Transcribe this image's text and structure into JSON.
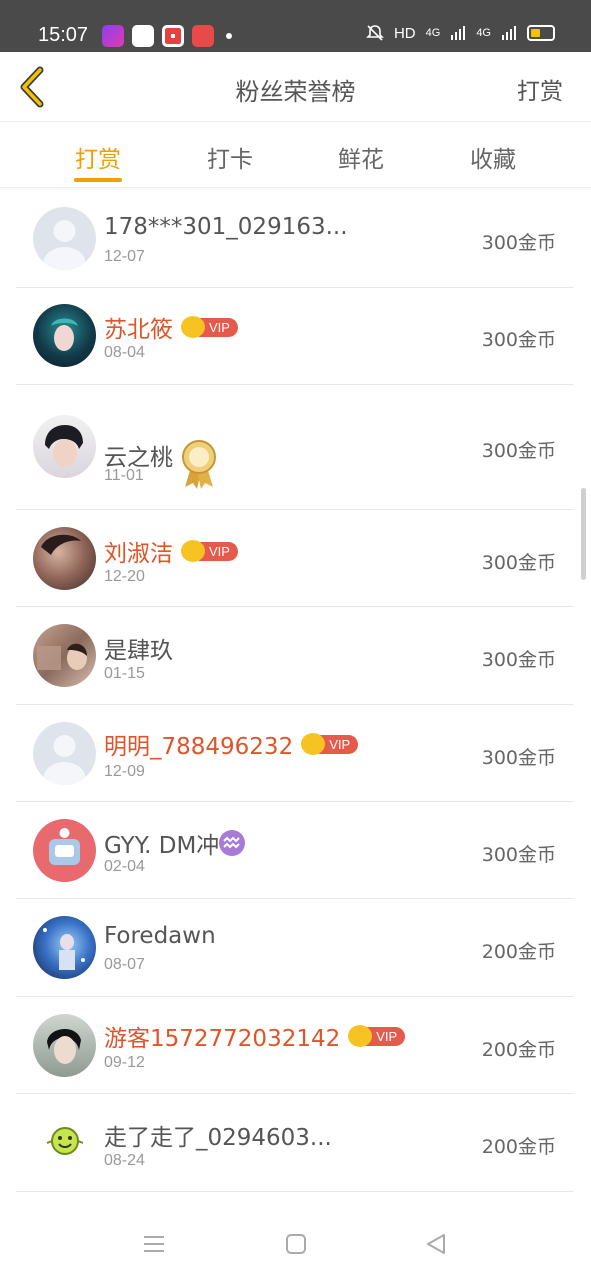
{
  "status": {
    "time": "15:07",
    "network": "HD",
    "sig1": "4G",
    "sig2": "4G"
  },
  "header": {
    "title": "粉丝荣誉榜",
    "action": "打赏"
  },
  "tabs": [
    {
      "label": "打赏",
      "active": true
    },
    {
      "label": "打卡",
      "active": false
    },
    {
      "label": "鲜花",
      "active": false
    },
    {
      "label": "收藏",
      "active": false
    }
  ],
  "vip_label": "VIP",
  "rows": [
    {
      "name": "178***301_029163...",
      "date": "12-07",
      "amount": "300金币",
      "vip": false,
      "badge": ""
    },
    {
      "name": "苏北筱",
      "date": "08-04",
      "amount": "300金币",
      "vip": true,
      "badge": "vip"
    },
    {
      "name": "云之桃",
      "date": "11-01",
      "amount": "300金币",
      "vip": false,
      "badge": "medal"
    },
    {
      "name": "刘淑洁",
      "date": "12-20",
      "amount": "300金币",
      "vip": true,
      "badge": "vip"
    },
    {
      "name": "是肆玖",
      "date": "01-15",
      "amount": "300金币",
      "vip": false,
      "badge": ""
    },
    {
      "name": "明明_788496232",
      "date": "12-09",
      "amount": "300金币",
      "vip": true,
      "badge": "vip"
    },
    {
      "name": "GYY. DM冲",
      "date": "02-04",
      "amount": "300金币",
      "vip": false,
      "badge": "zodiac"
    },
    {
      "name": "Foredawn",
      "date": "08-07",
      "amount": "200金币",
      "vip": false,
      "badge": ""
    },
    {
      "name": "游客1572772032142",
      "date": "09-12",
      "amount": "200金币",
      "vip": true,
      "badge": "vip"
    },
    {
      "name": "走了走了_0294603...",
      "date": "08-24",
      "amount": "200金币",
      "vip": false,
      "badge": ""
    }
  ],
  "colors": {
    "accent": "#f0a000",
    "vip_name": "#e0542a",
    "status_bar": "#4a4a4a"
  }
}
